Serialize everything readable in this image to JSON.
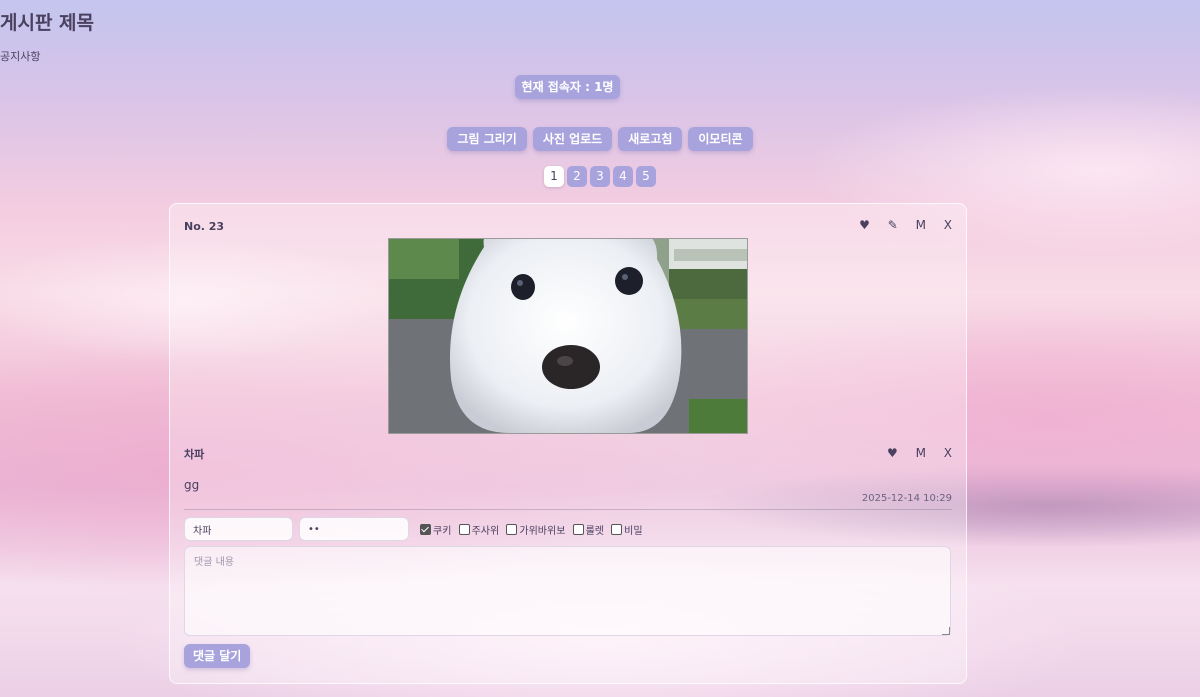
{
  "board": {
    "title": "게시판 제목",
    "notice": "공지사항",
    "online_label": "현재 접속자 : 1명"
  },
  "toolbar": {
    "draw": "그림 그리기",
    "upload": "사진 업로드",
    "refresh": "새로고침",
    "emoticon": "이모티콘"
  },
  "pagination": {
    "pages": [
      "1",
      "2",
      "3",
      "4",
      "5"
    ],
    "current": "1"
  },
  "post": {
    "number": "No. 23",
    "actions": {
      "like": "♥",
      "edit": "✎",
      "move": "M",
      "delete": "X"
    },
    "image_alt": "white puppy photo",
    "comment": {
      "author": "차파",
      "text": "gg",
      "timestamp": "2025-12-14 10:29",
      "actions": {
        "like": "♥",
        "move": "M",
        "delete": "X"
      }
    }
  },
  "comment_form": {
    "name_value": "차파",
    "password_value": "••",
    "options": [
      {
        "label": "쿠키",
        "checked": true
      },
      {
        "label": "주사위",
        "checked": false
      },
      {
        "label": "가위바위보",
        "checked": false
      },
      {
        "label": "룰렛",
        "checked": false
      },
      {
        "label": "비밀",
        "checked": false
      }
    ],
    "placeholder": "댓글 내용",
    "submit": "댓글 달기"
  },
  "colors": {
    "accent": "#a9a3dd",
    "text": "#4a4060"
  }
}
